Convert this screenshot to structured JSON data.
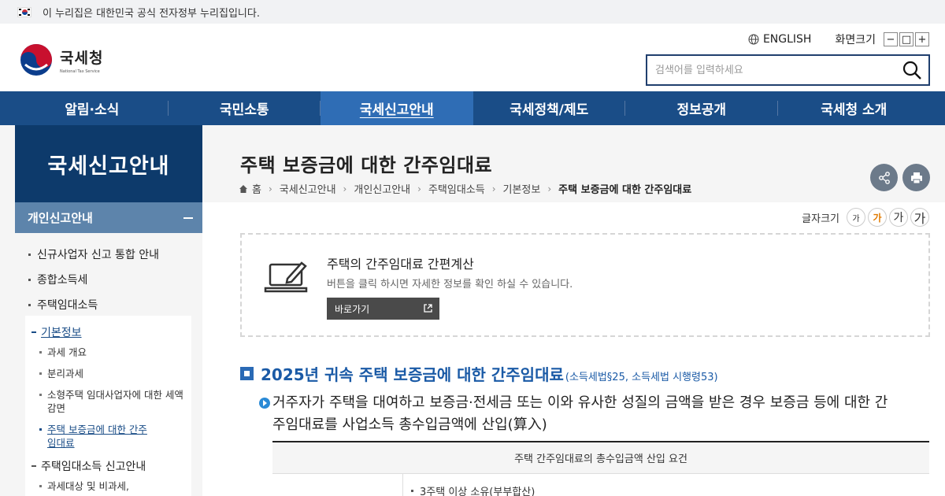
{
  "gov_banner": {
    "text": "이 누리집은 대한민국 공식 전자정부 누리집입니다."
  },
  "header": {
    "logo_ko": "국세청",
    "logo_en": "National Tax Service",
    "english_label": "ENGLISH",
    "zoom_label": "화면크기",
    "zoom_buttons": [
      "−",
      "□",
      "+"
    ],
    "search_placeholder": "검색어를 입력하세요"
  },
  "gnb": {
    "items": [
      "알림·소식",
      "국민소통",
      "국세신고안내",
      "국세정책/제도",
      "정보공개",
      "국세청 소개"
    ],
    "active_index": 2
  },
  "sidebar": {
    "title": "국세신고안내",
    "sub_title": "개인신고안내",
    "level1": [
      "신규사업자 신고 통합 안내",
      "종합소득세",
      "주택임대소득"
    ],
    "level2": [
      {
        "label": "기본정보",
        "active": true
      },
      {
        "label": "주택임대소득 신고안내",
        "active": false
      }
    ],
    "level3_basic": [
      {
        "label": "과세 개요",
        "active": false
      },
      {
        "label": "분리과세",
        "active": false
      },
      {
        "label": "소형주택 임대사업자에 대한 세액 감면",
        "active": false
      },
      {
        "label": "주택 보증금에 대한 간주임대료",
        "active": true
      }
    ],
    "level3_filing": [
      {
        "label": "과세대상 및 비과세,",
        "active": false
      }
    ]
  },
  "content": {
    "page_title": "주택 보증금에 대한 간주임대료",
    "breadcrumb": [
      "홈",
      "국세신고안내",
      "개인신고안내",
      "주택임대소득",
      "기본정보",
      "주택 보증금에 대한 간주임대료"
    ],
    "font_size_label": "글자크기",
    "font_size_buttons": [
      "가",
      "가",
      "가",
      "가"
    ],
    "calc": {
      "title": "주택의 간주임대료 간편계산",
      "desc": "버튼을 클릭 하시면 자세한 정보를 확인 하실 수 있습니다.",
      "button": "바로가기"
    },
    "section": {
      "title": "2025년 귀속 주택 보증금에 대한 간주임대료",
      "law": "(소득세법§25, 소득세법 시행령53)"
    },
    "paragraph": "거주자가 주택을 대여하고 보증금·전세금 또는 이와 유사한 성질의 금액을 받은 경우 보증금 등에 대한 간주임대료를 사업소득 총수입금액에 산입(算入)",
    "table": {
      "header": "주택 간주임대료의 총수입금액 산입 요건",
      "row1": "3주택 이상 소유(부부합산)"
    }
  },
  "colors": {
    "nav_bg": "#1a4d87",
    "nav_active": "#2f6db5",
    "sidebar_title_bg": "#0d3a6b",
    "sidebar_sub_bg": "#5d84ab",
    "section_blue": "#1a5aa6"
  }
}
